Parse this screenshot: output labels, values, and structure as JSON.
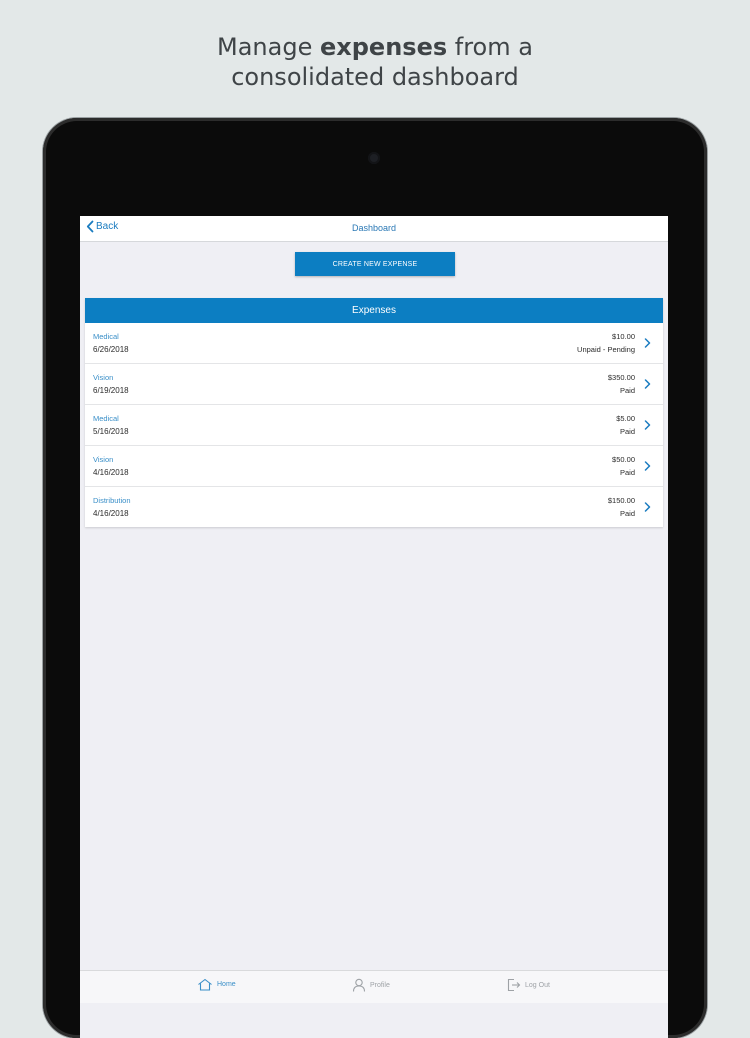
{
  "headline": {
    "line1_pre": "Manage ",
    "line1_bold": "expenses",
    "line1_post": " from a",
    "line2": "consolidated dashboard"
  },
  "navbar": {
    "back_label": "Back",
    "title": "Dashboard"
  },
  "create_button_label": "CREATE NEW EXPENSE",
  "expenses": {
    "header": "Expenses",
    "items": [
      {
        "category": "Medical",
        "date": "6/26/2018",
        "amount": "$10.00",
        "status": "Unpaid - Pending"
      },
      {
        "category": "Vision",
        "date": "6/19/2018",
        "amount": "$350.00",
        "status": "Paid"
      },
      {
        "category": "Medical",
        "date": "5/16/2018",
        "amount": "$5.00",
        "status": "Paid"
      },
      {
        "category": "Vision",
        "date": "4/16/2018",
        "amount": "$50.00",
        "status": "Paid"
      },
      {
        "category": "Distribution",
        "date": "4/16/2018",
        "amount": "$150.00",
        "status": "Paid"
      }
    ]
  },
  "tabbar": {
    "home": "Home",
    "profile": "Profile",
    "logout": "Log Out"
  },
  "colors": {
    "accent": "#0c7ec2",
    "link": "#3a8fc8",
    "background": "#efeff4",
    "page_background": "#e3e8e8"
  },
  "icons": {
    "back": "chevron-left-icon",
    "row": "chevron-right-icon",
    "home": "home-icon",
    "profile": "user-icon",
    "logout": "logout-icon"
  }
}
